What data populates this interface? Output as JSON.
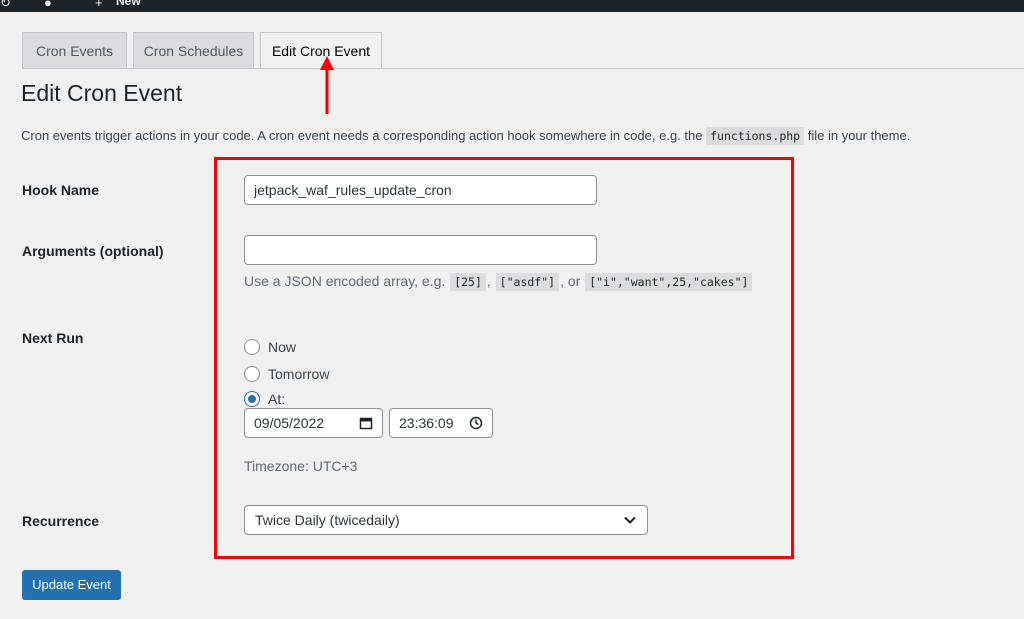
{
  "admin_bar": {
    "new_label": "New"
  },
  "tabs": [
    {
      "label": "Cron Events",
      "active": false
    },
    {
      "label": "Cron Schedules",
      "active": false
    },
    {
      "label": "Edit Cron Event",
      "active": true
    }
  ],
  "page": {
    "title": "Edit Cron Event",
    "intro_before": "Cron events trigger actions in your code. A cron event needs a corresponding action hook somewhere in code, e.g. the",
    "intro_code": "functions.php",
    "intro_after": "file in your theme."
  },
  "form": {
    "hook_name": {
      "label": "Hook Name",
      "value": "jetpack_waf_rules_update_cron"
    },
    "arguments": {
      "label": "Arguments (optional)",
      "value": "",
      "help_before": "Use a JSON encoded array, e.g.",
      "example_1": "[25]",
      "sep_1": ",",
      "example_2": "[\"asdf\"]",
      "sep_2": ", or",
      "example_3": "[\"i\",\"want\",25,\"cakes\"]"
    },
    "next_run": {
      "label": "Next Run",
      "options": [
        {
          "label": "Now",
          "checked": false
        },
        {
          "label": "Tomorrow",
          "checked": false
        },
        {
          "label": "At:",
          "checked": true
        }
      ],
      "date": "09/05/2022",
      "time": "23:36:09",
      "timezone": "Timezone: UTC+3"
    },
    "recurrence": {
      "label": "Recurrence",
      "selected": "Twice Daily (twicedaily)"
    },
    "submit_label": "Update Event"
  },
  "colors": {
    "primary": "#2271b1",
    "annotation": "#ff0000",
    "admin_bar": "#1d2327",
    "background": "#f0f0f1"
  }
}
